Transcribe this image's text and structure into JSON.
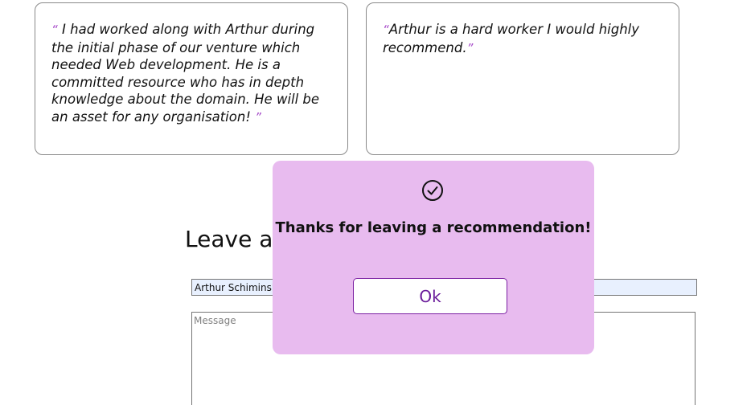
{
  "recommendations": [
    {
      "open_quote": "“",
      "text": " I had worked along with Arthur during the initial phase of our venture which needed Web development. He is a committed resource who has in depth knowledge about the domain. He will be an asset for any organisation! ",
      "close_quote": "”"
    },
    {
      "open_quote": "“",
      "text": "Arthur is a hard worker I would highly recommend.",
      "close_quote": "”"
    }
  ],
  "form": {
    "heading": "Leave a Recommendation",
    "name_value": "Arthur Schiminski",
    "message_placeholder": "Message"
  },
  "modal": {
    "icon": "check-circle-icon",
    "message": "Thanks for leaving a recommendation!",
    "ok_label": "Ok"
  },
  "colors": {
    "modal_background": "#e8bbef",
    "accent": "#7b1fa2",
    "quote_mark": "#a64ac9",
    "autofill_background": "#e8f0fe"
  }
}
